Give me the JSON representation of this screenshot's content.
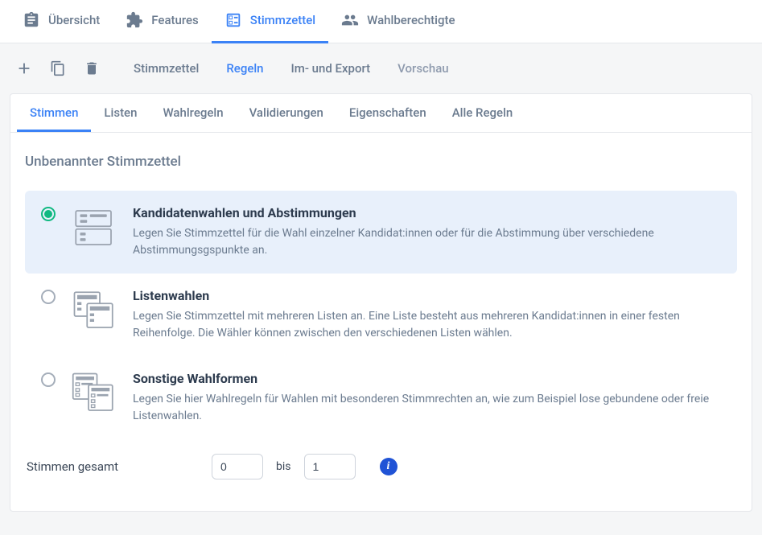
{
  "topNav": {
    "overview": "Übersicht",
    "features": "Features",
    "ballots": "Stimmzettel",
    "eligible": "Wahlberechtigte"
  },
  "actionBar": {
    "tab1": "Stimmzettel",
    "tab2": "Regeln",
    "tab3": "Im- und Export",
    "tab4": "Vorschau"
  },
  "innerTabs": {
    "votes": "Stimmen",
    "lists": "Listen",
    "rules": "Wahlregeln",
    "validations": "Validierungen",
    "properties": "Eigenschaften",
    "allRules": "Alle Regeln"
  },
  "content": {
    "title": "Unbenannter Stimmzettel",
    "options": {
      "opt1": {
        "title": "Kandidatenwahlen und Abstimmungen",
        "desc": "Legen Sie Stimmzettel für die Wahl einzelner Kandidat:innen oder für die Abstimmung über verschiedene Abstimmungsgspunkte an."
      },
      "opt2": {
        "title": "Listenwahlen",
        "desc": "Legen Sie Stimmzettel mit mehreren Listen an. Eine Liste besteht aus mehreren Kandidat:innen in einer festen Reihenfolge. Die Wähler können zwischen den verschiedenen Listen wählen."
      },
      "opt3": {
        "title": "Sonstige Wahlformen",
        "desc": "Legen Sie hier Wahlregeln für Wahlen mit besonderen Stimmrechten an, wie zum Beispiel lose gebundene oder freie Listenwahlen."
      }
    },
    "total": {
      "label": "Stimmen gesamt",
      "from": "0",
      "between": "bis",
      "to": "1"
    }
  }
}
